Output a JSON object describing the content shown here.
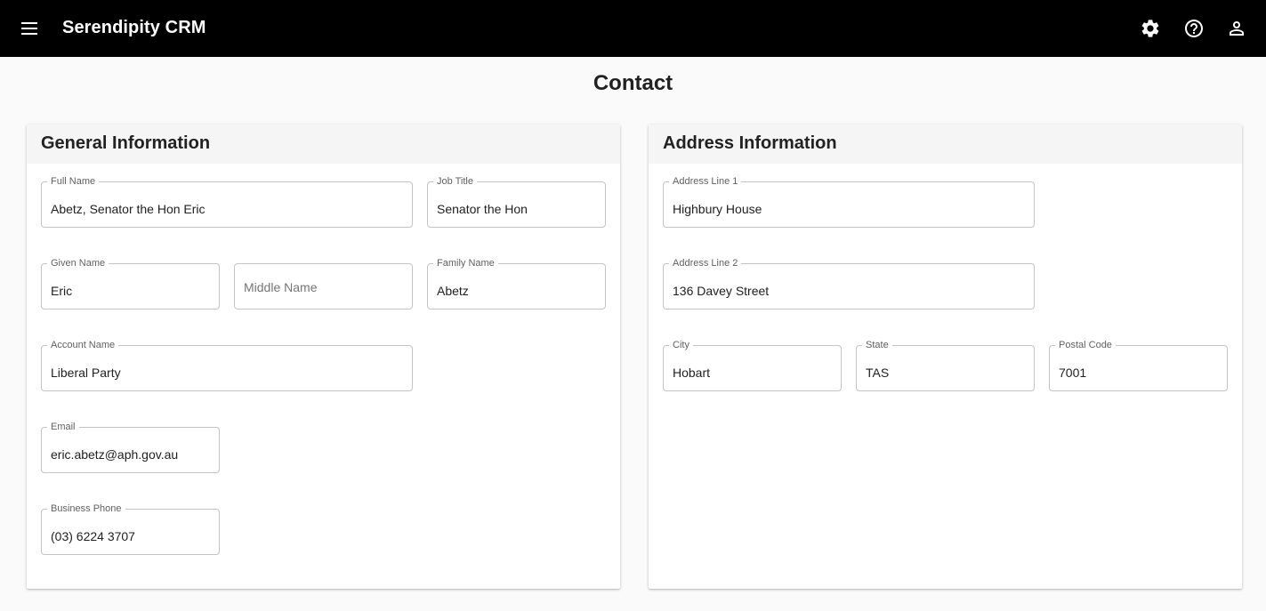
{
  "app": {
    "title": "Serendipity CRM"
  },
  "icons": {
    "menu": "hamburger-menu-icon",
    "settings": "gear-icon",
    "help": "help-circle-icon",
    "account": "user-icon"
  },
  "page": {
    "title": "Contact"
  },
  "general": {
    "heading": "General Information",
    "full_name": {
      "label": "Full Name",
      "value": "Abetz, Senator the Hon Eric"
    },
    "job_title": {
      "label": "Job Title",
      "value": "Senator the Hon"
    },
    "given_name": {
      "label": "Given Name",
      "value": "Eric"
    },
    "middle_name": {
      "placeholder": "Middle Name",
      "value": ""
    },
    "family_name": {
      "label": "Family Name",
      "value": "Abetz"
    },
    "account_name": {
      "label": "Account Name",
      "value": "Liberal Party"
    },
    "email": {
      "label": "Email",
      "value": "eric.abetz@aph.gov.au"
    },
    "business_phone": {
      "label": "Business Phone",
      "value": "(03) 6224 3707"
    }
  },
  "address": {
    "heading": "Address Information",
    "line1": {
      "label": "Address Line 1",
      "value": "Highbury House"
    },
    "line2": {
      "label": "Address Line 2",
      "value": "136 Davey Street"
    },
    "city": {
      "label": "City",
      "value": "Hobart"
    },
    "state": {
      "label": "State",
      "value": "TAS"
    },
    "postal_code": {
      "label": "Postal Code",
      "value": "7001"
    }
  }
}
